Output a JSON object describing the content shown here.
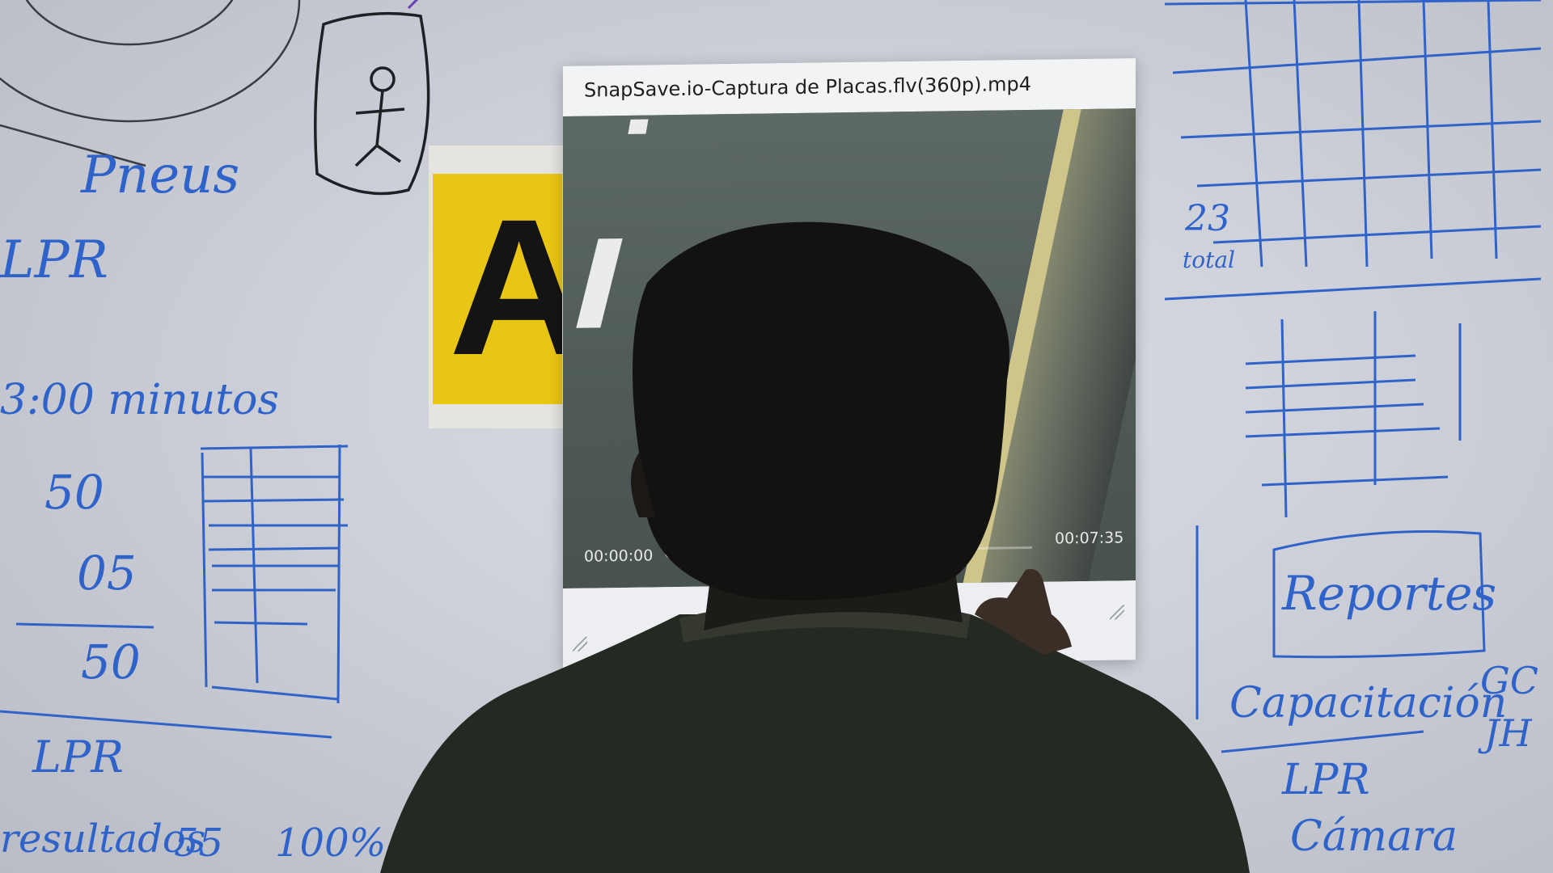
{
  "player": {
    "title": "SnapSave.io-Captura de Placas.flv(360p).mp4",
    "current_time": "00:00:00",
    "total_time": "00:07:35",
    "progress": 0
  },
  "sign": {
    "letters": "AZ"
  },
  "whiteboard": {
    "left_notes": [
      "Pneus",
      "LPR",
      "3:00 minutos",
      "50",
      "05",
      "50",
      "LPR",
      "resultados",
      "55",
      "100%"
    ],
    "right_notes": [
      "23",
      "total",
      "Reportes",
      "Capacitación",
      "GC",
      "JH",
      "LPR",
      "Cámara"
    ]
  },
  "colors": {
    "ink": "#2f63c9",
    "sign_yellow": "#e9c514",
    "player_chrome": "#eceef1"
  }
}
